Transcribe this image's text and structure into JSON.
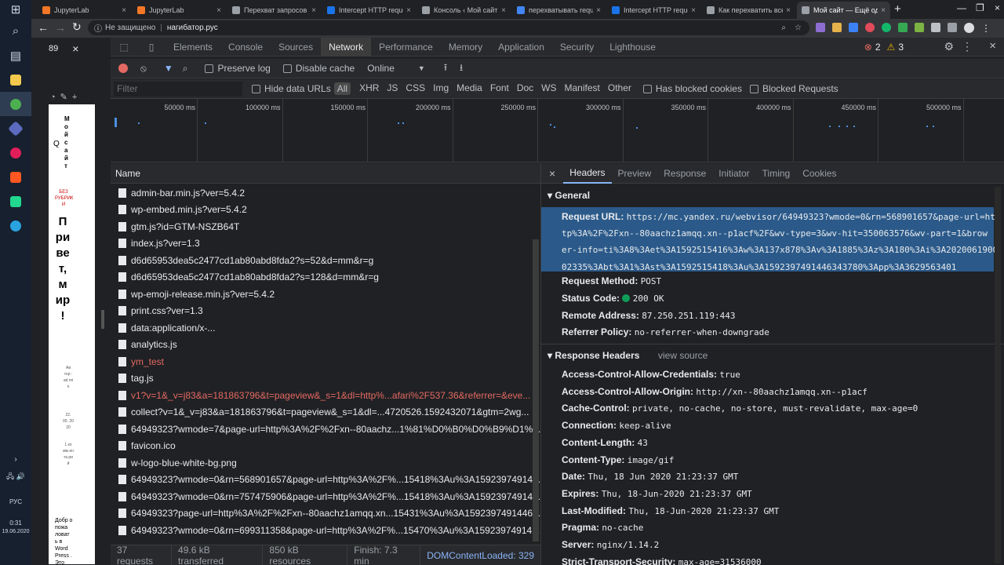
{
  "taskbar": {
    "icons": [
      "search-icon",
      "taskview-icon",
      "files-icon",
      "chrome-icon",
      "app-icon",
      "app-icon",
      "app-icon",
      "app-icon",
      "telegram-icon"
    ],
    "lang": "РУС",
    "time": "0:31",
    "date": "19.06.2020"
  },
  "tabs": [
    {
      "title": "JupyterLab",
      "color": "#f37726",
      "active": false
    },
    {
      "title": "JupyterLab",
      "color": "#f37726",
      "active": false
    },
    {
      "title": "Перехват запросов п",
      "color": "#9aa0a6",
      "active": false
    },
    {
      "title": "Intercept HTTP reque",
      "color": "#1a73e8",
      "active": false
    },
    {
      "title": "Консоль ‹ Мой сайт",
      "color": "#9aa0a6",
      "active": false
    },
    {
      "title": "перехватывать reque",
      "color": "#4285f4",
      "active": false
    },
    {
      "title": "Intercept HTTP reque",
      "color": "#1a73e8",
      "active": false
    },
    {
      "title": "Как перехватить все",
      "color": "#9aa0a6",
      "active": false
    },
    {
      "title": "Мой сайт — Ещё оди",
      "color": "#9aa0a6",
      "active": true
    }
  ],
  "address": {
    "security": "Не защищено",
    "url": "нагибатор.рус"
  },
  "page": {
    "counter": "89",
    "site_title": "М о й с а й т",
    "category": "БЕЗ РУБРИК И",
    "heading": "П ри ве т, м ир !",
    "author": "Ав тор : ad mi n",
    "date": "22. 05. 20 20",
    "comments": "1 ко мм ен та ри й",
    "body": "Добр о пожа ловат ь в Word Press . Это ваша"
  },
  "devtools": {
    "panels": [
      "Elements",
      "Console",
      "Sources",
      "Network",
      "Performance",
      "Memory",
      "Application",
      "Security",
      "Lighthouse"
    ],
    "active_panel": "Network",
    "errors": "2",
    "warnings": "3",
    "controls": {
      "preserve_log": "Preserve log",
      "disable_cache": "Disable cache",
      "throttle": "Online"
    },
    "filter": {
      "placeholder": "Filter",
      "hide_data": "Hide data URLs",
      "types": [
        "All",
        "XHR",
        "JS",
        "CSS",
        "Img",
        "Media",
        "Font",
        "Doc",
        "WS",
        "Manifest",
        "Other"
      ],
      "blocked_cookies": "Has blocked cookies",
      "blocked_requests": "Blocked Requests"
    },
    "timeline_ticks": [
      "50000 ms",
      "100000 ms",
      "150000 ms",
      "200000 ms",
      "250000 ms",
      "300000 ms",
      "350000 ms",
      "400000 ms",
      "450000 ms",
      "500000 ms"
    ],
    "name_header": "Name",
    "requests": [
      {
        "name": "admin-bar.min.js?ver=5.4.2",
        "error": false
      },
      {
        "name": "wp-embed.min.js?ver=5.4.2",
        "error": false
      },
      {
        "name": "gtm.js?id=GTM-NSZB64T",
        "error": false
      },
      {
        "name": "index.js?ver=1.3",
        "error": false
      },
      {
        "name": "d6d65953dea5c2477cd1ab80abd8fda2?s=52&d=mm&r=g",
        "error": false
      },
      {
        "name": "d6d65953dea5c2477cd1ab80abd8fda2?s=128&d=mm&r=g",
        "error": false
      },
      {
        "name": "wp-emoji-release.min.js?ver=5.4.2",
        "error": false
      },
      {
        "name": "print.css?ver=1.3",
        "error": false
      },
      {
        "name": "data:application/x-...",
        "error": false
      },
      {
        "name": "analytics.js",
        "error": false
      },
      {
        "name": "ym_test",
        "error": true
      },
      {
        "name": "tag.js",
        "error": false
      },
      {
        "name": "v1?v=1&_v=j83&a=181863796&t=pageview&_s=1&dl=http%...afari%2F537.36&referrer=&eve...",
        "error": true
      },
      {
        "name": "collect?v=1&_v=j83&a=181863796&t=pageview&_s=1&dl=...4720526.1592432071&gtm=2wg...",
        "error": false
      },
      {
        "name": "64949323?wmode=7&page-url=http%3A%2F%2Fxn--80aachz...1%81%D0%B0%D0%B9%D1%8...",
        "error": false
      },
      {
        "name": "favicon.ico",
        "error": false
      },
      {
        "name": "w-logo-blue-white-bg.png",
        "error": false
      },
      {
        "name": "64949323?wmode=0&rn=568901657&page-url=http%3A%2F%...15418%3Au%3A15923974914...",
        "error": false
      },
      {
        "name": "64949323?wmode=0&rn=757475906&page-url=http%3A%2F%...15418%3Au%3A15923974914...",
        "error": false
      },
      {
        "name": "64949323?page-url=http%3A%2F%2Fxn--80aachz1amqq.xn...15431%3Au%3A15923974914463...",
        "error": false
      },
      {
        "name": "64949323?wmode=0&rn=699311358&page-url=http%3A%2F%...15470%3Au%3A15923974914...",
        "error": false
      }
    ],
    "status": {
      "requests": "37 requests",
      "transferred": "49.6 kB transferred",
      "resources": "850 kB resources",
      "finish": "Finish: 7.3 min",
      "dcl": "DOMContentLoaded: 329"
    },
    "detail_tabs": [
      "Headers",
      "Preview",
      "Response",
      "Initiator",
      "Timing",
      "Cookies"
    ],
    "general": {
      "title": "General",
      "request_url_label": "Request URL:",
      "request_url_lines": [
        "https://mc.yandex.ru/webvisor/64949323?wmode=0&rn=568901657&page-url=ht",
        "tp%3A%2F%2Fxn--80aachz1amqq.xn--p1acf%2F&wv-type=3&wv-hit=350063576&wv-part=1&brow",
        "er-info=ti%3A8%3Aet%3A1592515416%3Aw%3A137x878%3Av%3A1885%3Az%3A180%3Ai%3A2020061900",
        "02335%3Abt%3A1%3Ast%3A1592515418%3Au%3A1592397491446343780%3App%3A3629563401"
      ],
      "method_label": "Request Method:",
      "method": "POST",
      "status_label": "Status Code:",
      "status": "200 OK",
      "remote_label": "Remote Address:",
      "remote": "87.250.251.119:443",
      "referrer_label": "Referrer Policy:",
      "referrer": "no-referrer-when-downgrade"
    },
    "response": {
      "title": "Response Headers",
      "view_source": "view source",
      "headers": [
        {
          "k": "Access-Control-Allow-Credentials:",
          "v": "true"
        },
        {
          "k": "Access-Control-Allow-Origin:",
          "v": "http://xn--80aachz1amqq.xn--p1acf"
        },
        {
          "k": "Cache-Control:",
          "v": "private, no-cache, no-store, must-revalidate, max-age=0"
        },
        {
          "k": "Connection:",
          "v": "keep-alive"
        },
        {
          "k": "Content-Length:",
          "v": "43"
        },
        {
          "k": "Content-Type:",
          "v": "image/gif"
        },
        {
          "k": "Date:",
          "v": "Thu, 18 Jun 2020 21:23:37 GMT"
        },
        {
          "k": "Expires:",
          "v": "Thu, 18-Jun-2020 21:23:37 GMT"
        },
        {
          "k": "Last-Modified:",
          "v": "Thu, 18-Jun-2020 21:23:37 GMT"
        },
        {
          "k": "Pragma:",
          "v": "no-cache"
        },
        {
          "k": "Server:",
          "v": "nginx/1.14.2"
        },
        {
          "k": "Strict-Transport-Security:",
          "v": "max-age=31536000"
        }
      ]
    }
  }
}
